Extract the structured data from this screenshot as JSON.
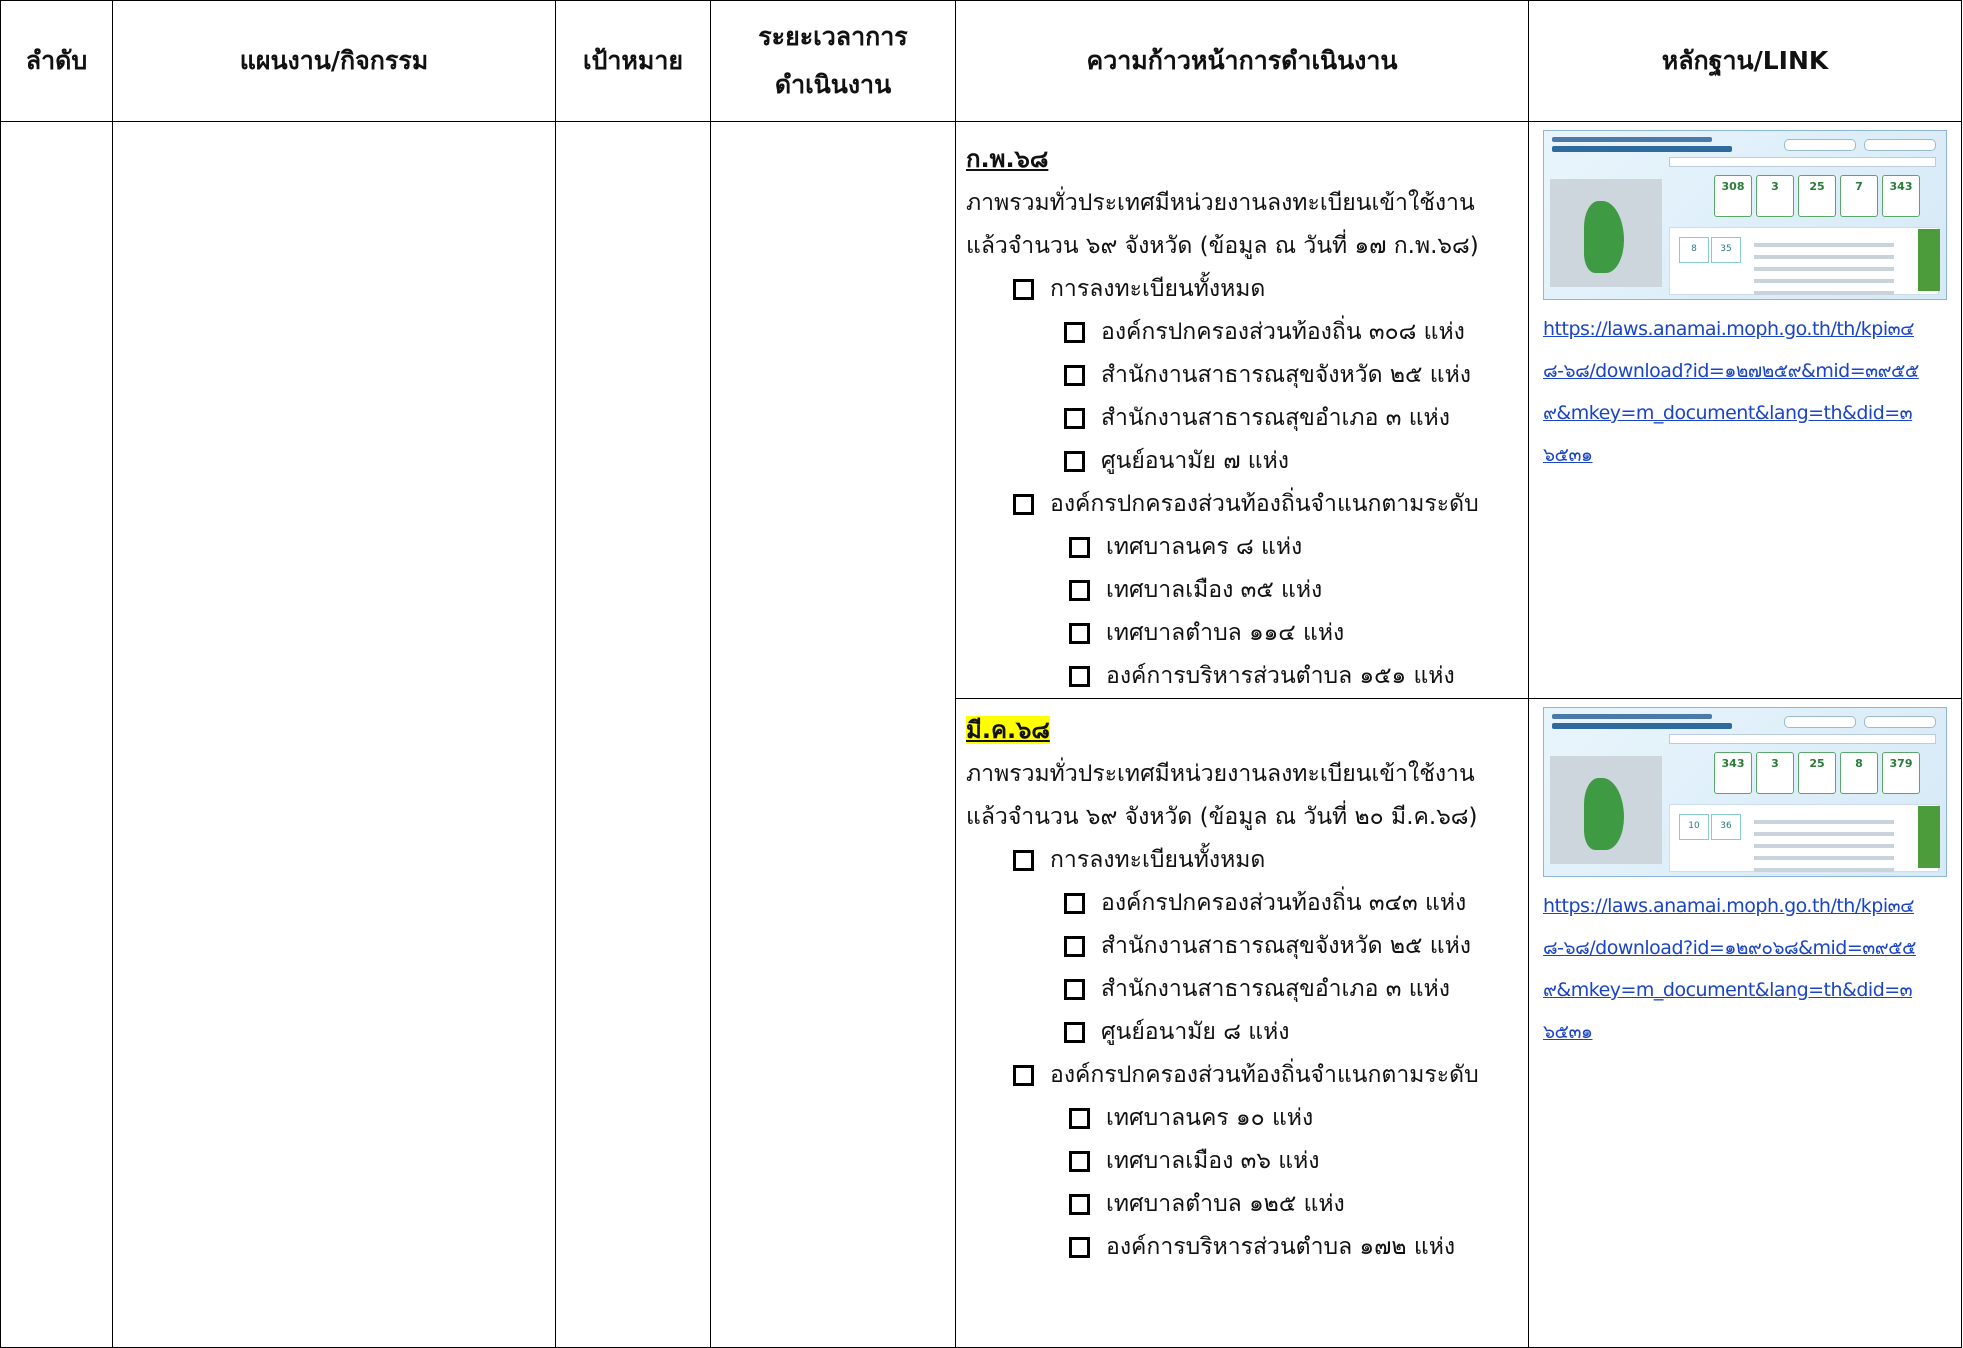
{
  "header": {
    "col1": "ลำดับ",
    "col2": "แผนงาน/กิจกรรม",
    "col3": "เป้าหมาย",
    "col4": "ระยะเวลาการดำเนินงาน",
    "col5": "ความก้าวหน้าการดำเนินงาน",
    "col6": "หลักฐาน/LINK"
  },
  "entries": [
    {
      "month": "ก.พ.๖๘",
      "summary_1": "ภาพรวมทั่วประเทศมีหน่วยงานลงทะเบียนเข้าใช้งาน",
      "summary_2": "แล้วจำนวน ๖๙ จังหวัด (ข้อมูล ณ วันที่ ๑๗ ก.พ.๖๘)",
      "group1_title": "การลงทะเบียนทั้งหมด",
      "group1_items": [
        "องค์กรปกครองส่วนท้องถิ่น ๓๐๘ แห่ง",
        "สำนักงานสาธารณสุขจังหวัด ๒๕ แห่ง",
        "สำนักงานสาธารณสุขอำเภอ ๓ แห่ง",
        "ศูนย์อนามัย ๗ แห่ง"
      ],
      "group2_title": "องค์กรปกครองส่วนท้องถิ่นจำแนกตามระดับ",
      "group2_items": [
        "เทศบาลนคร ๘ แห่ง",
        "เทศบาลเมือง ๓๕ แห่ง",
        "เทศบาลตำบล ๑๑๔ แห่ง",
        "องค์การบริหารส่วนตำบล ๑๕๑ แห่ง"
      ],
      "link": "https://laws.anamai.moph.go.th/th/kpi๓๔๘-๖๘/download?id=๑๒๗๒๕๙&mid=๓๙๕๕๙&mkey=m_document&lang=th&did=๓๖๕๓๑",
      "thumb_values": [
        "308",
        "3",
        "25",
        "7",
        "343"
      ]
    },
    {
      "month": "มี.ค.๖๘",
      "summary_1": "ภาพรวมทั่วประเทศมีหน่วยงานลงทะเบียนเข้าใช้งาน",
      "summary_2": "แล้วจำนวน ๖๙  จังหวัด (ข้อมูล ณ วันที่ ๒๐ มี.ค.๖๘)",
      "group1_title": "การลงทะเบียนทั้งหมด",
      "group1_items": [
        "องค์กรปกครองส่วนท้องถิ่น ๓๔๓ แห่ง",
        "สำนักงานสาธารณสุขจังหวัด ๒๕ แห่ง",
        "สำนักงานสาธารณสุขอำเภอ ๓ แห่ง",
        "ศูนย์อนามัย  ๘ แห่ง"
      ],
      "group2_title": "องค์กรปกครองส่วนท้องถิ่นจำแนกตามระดับ",
      "group2_items": [
        "เทศบาลนคร ๑๐ แห่ง",
        "เทศบาลเมือง ๓๖ แห่ง",
        "เทศบาลตำบล ๑๒๕ แห่ง",
        "องค์การบริหารส่วนตำบล ๑๗๒ แห่ง"
      ],
      "link": "https://laws.anamai.moph.go.th/th/kpi๓๔๘-๖๘/download?id=๑๒๙๐๖๘&mid=๓๙๕๕๙&mkey=m_document&lang=th&did=๓๖๕๓๑",
      "thumb_values": [
        "343",
        "3",
        "25",
        "8",
        "379"
      ]
    }
  ]
}
